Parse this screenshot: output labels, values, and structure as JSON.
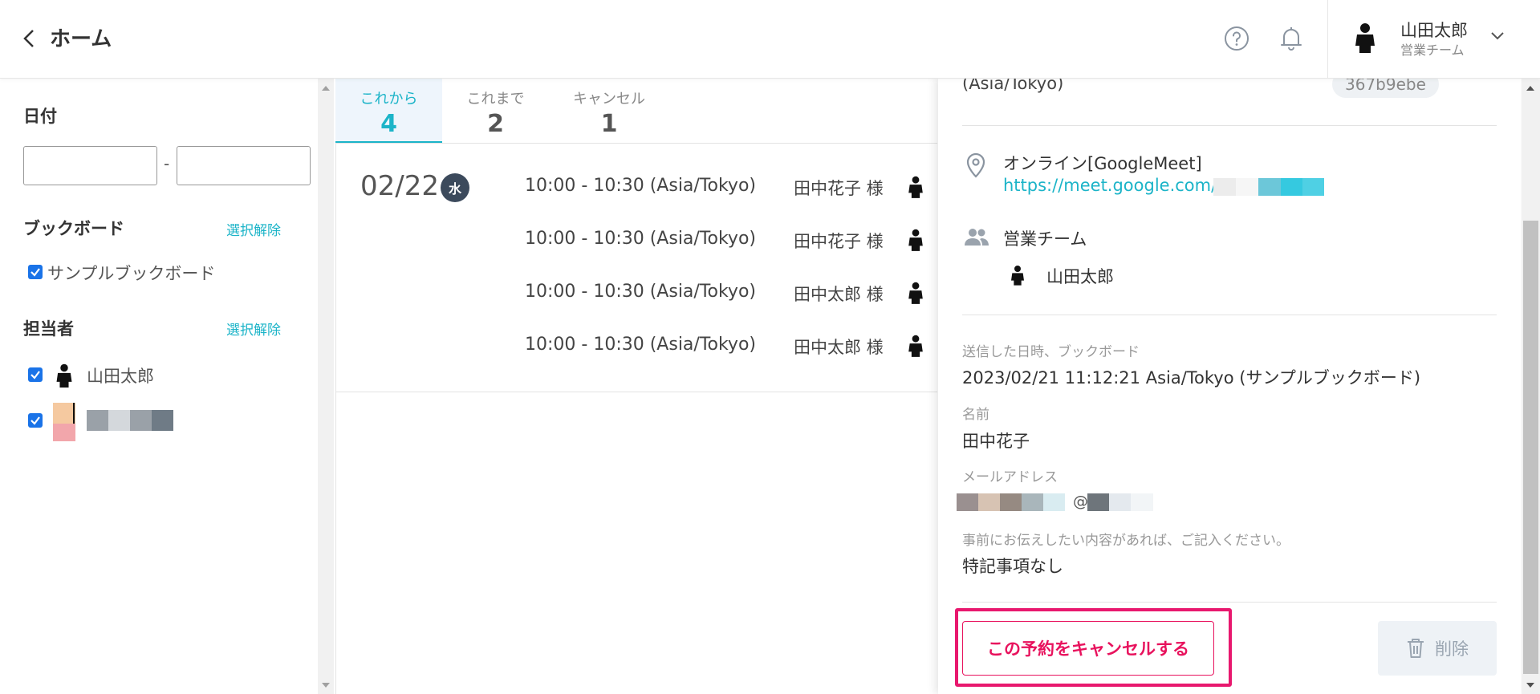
{
  "header": {
    "title": "ホーム",
    "user_name": "山田太郎",
    "user_team": "営業チーム"
  },
  "filters": {
    "date_label": "日付",
    "date_separator": "-",
    "date_from": "",
    "date_to": "",
    "bookboard_label": "ブックボード",
    "bookboard_clear": "選択解除",
    "bookboards": [
      "サンプルブックボード"
    ],
    "assignee_label": "担当者",
    "assignee_clear": "選択解除",
    "assignees": [
      "山田太郎"
    ]
  },
  "tabs": [
    {
      "label": "これから",
      "count": "4",
      "active": true
    },
    {
      "label": "これまで",
      "count": "2",
      "active": false
    },
    {
      "label": "キャンセル",
      "count": "1",
      "active": false
    }
  ],
  "list": {
    "date": "02/22",
    "day_of_week": "水",
    "appointments": [
      {
        "time": "10:00 - 10:30 (Asia/Tokyo)",
        "guest": "田中花子 様"
      },
      {
        "time": "10:00 - 10:30 (Asia/Tokyo)",
        "guest": "田中花子 様"
      },
      {
        "time": "10:00 - 10:30 (Asia/Tokyo)",
        "guest": "田中太郎 様"
      },
      {
        "time": "10:00 - 10:30 (Asia/Tokyo)",
        "guest": "田中太郎 様"
      }
    ]
  },
  "detail": {
    "timezone_tail": "(Asia/Tokyo)",
    "booking_id": "367b9ebe",
    "location_type": "オンライン[GoogleMeet]",
    "meet_link": "https://meet.google.com/",
    "team_name": "営業チーム",
    "team_member": "山田太郎",
    "sent_at_label": "送信した日時、ブックボード",
    "sent_at_value": "2023/02/21 11:12:21 Asia/Tokyo (サンプルブックボード)",
    "name_label": "名前",
    "name_value": "田中花子",
    "email_label": "メールアドレス",
    "email_at": "@",
    "notes_label": "事前にお伝えしたい内容があれば、ご記入ください。",
    "notes_value": "特記事項なし",
    "cancel_button": "この予約をキャンセルする",
    "delete_button": "削除"
  },
  "colors": {
    "accent": "#1cb4c8",
    "danger": "#e8125d",
    "checkbox": "#1a73e8"
  }
}
